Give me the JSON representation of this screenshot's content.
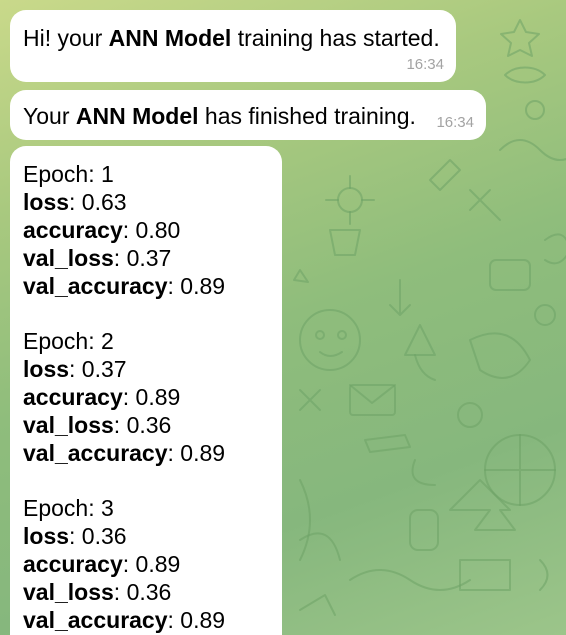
{
  "messages": [
    {
      "text_before": "Hi! your ",
      "bold": "ANN Model",
      "text_after": " training has started.",
      "time": "16:34"
    },
    {
      "text_before": "Your ",
      "bold": "ANN Model",
      "text_after": " has finished training.",
      "time": "16:34"
    }
  ],
  "epochs": [
    {
      "epoch_label": "Epoch",
      "epoch_value": ": 1",
      "loss_label": "loss",
      "loss_value": ": 0.63",
      "accuracy_label": "accuracy",
      "accuracy_value": ": 0.80",
      "val_loss_label": "val_loss",
      "val_loss_value": ": 0.37",
      "val_accuracy_label": "val_accuracy",
      "val_accuracy_value": ": 0.89"
    },
    {
      "epoch_label": "Epoch",
      "epoch_value": ": 2",
      "loss_label": "loss",
      "loss_value": ": 0.37",
      "accuracy_label": "accuracy",
      "accuracy_value": ": 0.89",
      "val_loss_label": "val_loss",
      "val_loss_value": ": 0.36",
      "val_accuracy_label": "val_accuracy",
      "val_accuracy_value": ": 0.89"
    },
    {
      "epoch_label": "Epoch",
      "epoch_value": ": 3",
      "loss_label": "loss",
      "loss_value": ": 0.36",
      "accuracy_label": "accuracy",
      "accuracy_value": ": 0.89",
      "val_loss_label": "val_loss",
      "val_loss_value": ": 0.36",
      "val_accuracy_label": "val_accuracy",
      "val_accuracy_value": ": 0.89"
    }
  ],
  "colors": {
    "bubble": "#ffffff",
    "timestamp": "#a3a3a3",
    "background_green": "#8fbd7c",
    "doodle": "#6ea266"
  }
}
